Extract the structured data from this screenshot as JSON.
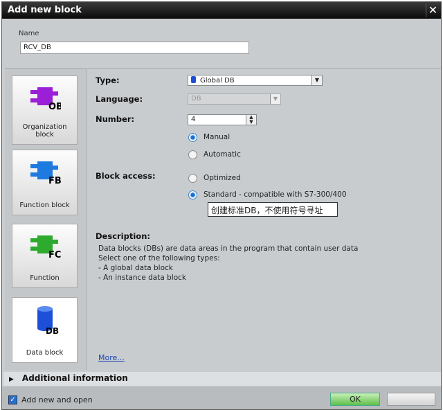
{
  "window": {
    "title": "Add new block",
    "close_icon": "close-icon"
  },
  "name": {
    "label": "Name",
    "value": "RCV_DB"
  },
  "block_types": [
    {
      "label": "Organization block",
      "badge": "OB",
      "color": "#9b1fd6"
    },
    {
      "label": "Function block",
      "badge": "FB",
      "color": "#1f7ae0"
    },
    {
      "label": "Function",
      "badge": "FC",
      "color": "#2eaa2e"
    },
    {
      "label": "Data block",
      "badge": "DB",
      "color": "#1d4fd8",
      "selected": true
    }
  ],
  "form": {
    "type_label": "Type:",
    "type_value": "Global DB",
    "language_label": "Language:",
    "language_value": "DB",
    "number_label": "Number:",
    "number_value": "4",
    "number_modes": [
      {
        "label": "Manual",
        "checked": true
      },
      {
        "label": "Automatic",
        "checked": false
      }
    ],
    "access_label": "Block access:",
    "access_modes": [
      {
        "label": "Optimized",
        "checked": false
      },
      {
        "label": "Standard - compatible with S7-300/400",
        "checked": true
      }
    ],
    "tooltip": "创建标准DB，不使用符号寻址"
  },
  "description": {
    "title": "Description:",
    "lines": [
      "Data blocks (DBs) are data areas in the program that contain user data",
      "Select one of the following types:",
      "- A global data block",
      "- An instance data block"
    ],
    "more": "More..."
  },
  "additional_info": "Additional  information",
  "footer": {
    "add_open_label": "Add new and open",
    "add_open_checked": true,
    "ok": "OK"
  }
}
